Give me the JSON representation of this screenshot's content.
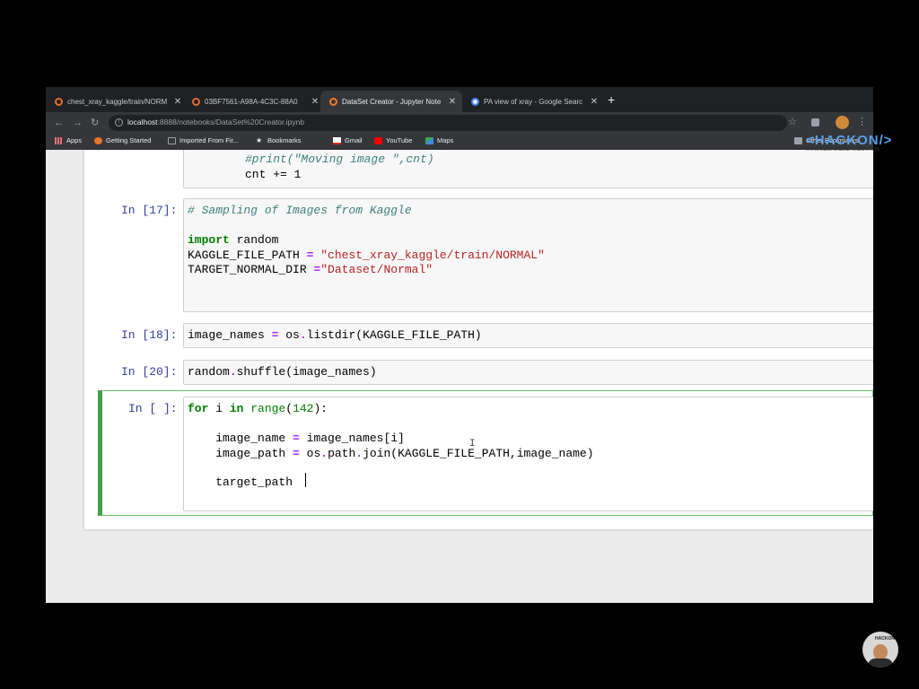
{
  "browser": {
    "tabs": [
      {
        "title": "chest_xray_kaggle/train/NORM",
        "favicon": "jupyter-icon",
        "active": false
      },
      {
        "title": "03BF7561-A98A-4C3C-88A0",
        "favicon": "jupyter-icon",
        "active": false
      },
      {
        "title": "DataSet Creator - Jupyter Note",
        "favicon": "jupyter-icon",
        "active": true
      },
      {
        "title": "PA view of xray - Google Searc",
        "favicon": "google-icon",
        "active": false
      }
    ],
    "close_glyph": "✕",
    "new_tab_glyph": "+",
    "url_host": "localhost",
    "url_rest": ":8888/notebooks/DataSet%20Creator.ipynb",
    "bookmarks": [
      {
        "label": "Apps",
        "icon": "apps-grid-icon"
      },
      {
        "label": "Getting Started",
        "icon": "firefox-icon"
      },
      {
        "label": "Imported From Fir...",
        "icon": "folder-icon"
      },
      {
        "label": "Bookmarks",
        "icon": "star-icon"
      },
      {
        "label": "Gmail",
        "icon": "gmail-icon"
      },
      {
        "label": "YouTube",
        "icon": "youtube-icon"
      },
      {
        "label": "Maps",
        "icon": "maps-icon"
      }
    ],
    "other_bookmarks": "Other Bookmarks"
  },
  "notebook": {
    "cells": [
      {
        "prompt": "",
        "lines": [
          "#print(\"Moving image \",cnt)",
          "cnt += 1"
        ]
      },
      {
        "prompt": "In [17]:",
        "lines": [
          "# Sampling of Images from Kaggle",
          "",
          "import random",
          "KAGGLE_FILE_PATH = \"chest_xray_kaggle/train/NORMAL\"",
          "TARGET_NORMAL_DIR =\"Dataset/Normal\""
        ]
      },
      {
        "prompt": "In [18]:",
        "lines": [
          "image_names = os.listdir(KAGGLE_FILE_PATH)"
        ]
      },
      {
        "prompt": "In [20]:",
        "lines": [
          "random.shuffle(image_names)"
        ]
      },
      {
        "prompt": "In [ ]:",
        "lines": [
          "for i in range(142):",
          "",
          "    image_name = image_names[i]",
          "    image_path = os.path.join(KAGGLE_FILE_PATH,image_name)",
          "",
          "    target_path "
        ]
      }
    ]
  },
  "watermark": {
    "logo": "<HACKON/>",
    "sub": "A PAN-INDIA ONLINE HACKATHON"
  },
  "presenter": {
    "tag": "HACKON"
  }
}
